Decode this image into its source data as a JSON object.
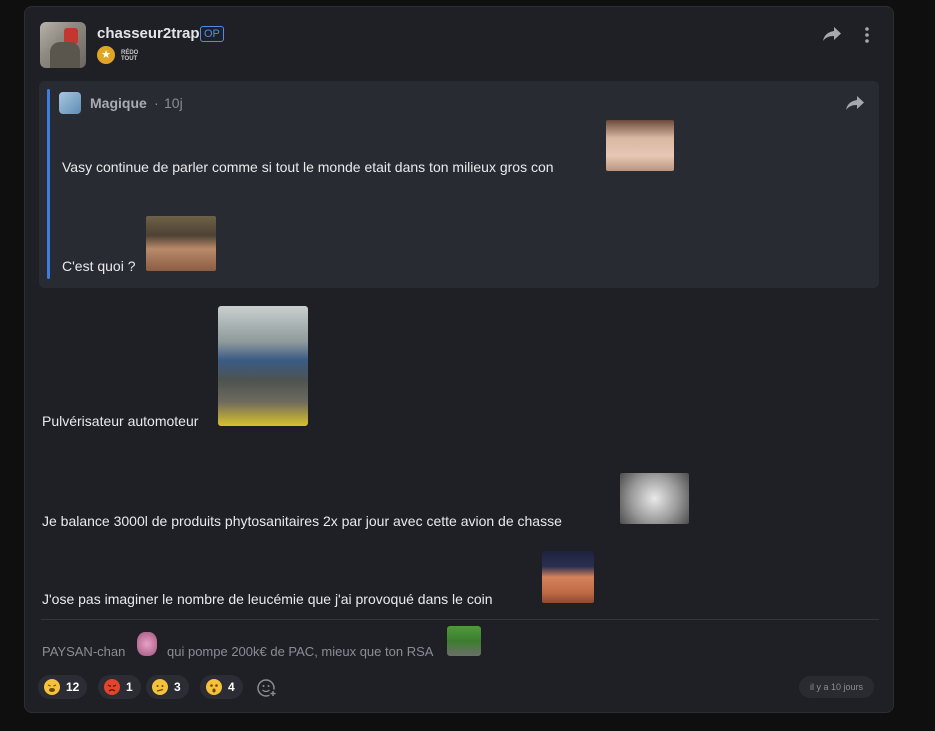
{
  "post": {
    "username": "chasseur2trap",
    "op_label": "OP",
    "badge_text": "RÉDO TOUT",
    "quote": {
      "author": "Magique",
      "separator": "·",
      "time": "10j",
      "line1": "Vasy continue de parler comme si tout le monde etait dans ton milieux gros con",
      "line2": "C'est quoi ?"
    },
    "body": {
      "line1": "Pulvérisateur automoteur",
      "line2": "Je balance 3000l de produits phytosanitaires 2x par jour avec cette avion de chasse",
      "line3": "J'ose pas imaginer le nombre de leucémie que j'ai provoqué dans le coin"
    },
    "signature": {
      "part1": "PAYSAN-chan",
      "part2": "qui pompe 200k€ de PAC, mieux que ton RSA"
    },
    "reactions": [
      {
        "icon": "tired-face-emoji-icon",
        "count": "12"
      },
      {
        "icon": "angry-face-emoji-icon",
        "count": "1"
      },
      {
        "icon": "confused-face-emoji-icon",
        "count": "3"
      },
      {
        "icon": "astonished-face-emoji-icon",
        "count": "4"
      }
    ],
    "timestamp": "il y a 10 jours"
  },
  "colors": {
    "background": "#0f0f10",
    "card": "#1f2026",
    "quote_bg": "#292b33",
    "accent_blue": "#3a7fe0",
    "reaction_yellow": "#f4c23b",
    "reaction_red": "#e2452a"
  }
}
